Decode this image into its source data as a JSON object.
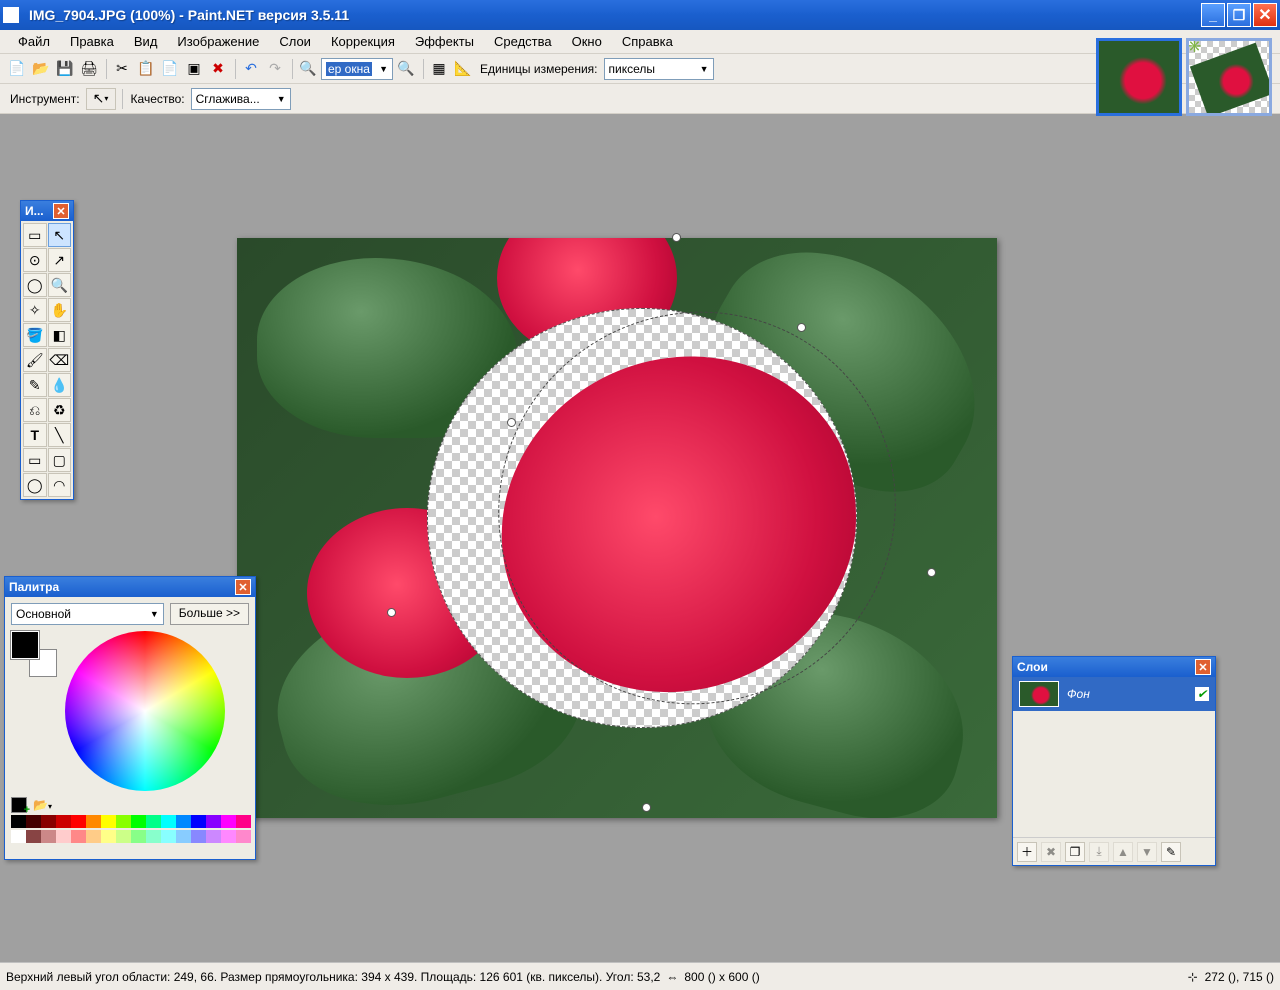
{
  "title": "IMG_7904.JPG (100%) - Paint.NET версия 3.5.11",
  "menu": {
    "file": "Файл",
    "edit": "Правка",
    "view": "Вид",
    "image": "Изображение",
    "layers": "Слои",
    "adjust": "Коррекция",
    "effects": "Эффекты",
    "tools": "Средства",
    "window": "Окно",
    "help": "Справка"
  },
  "toolbar1": {
    "zoom_select": "ер окна",
    "units_label": "Единицы измерения:",
    "units_value": "пикселы"
  },
  "toolbar2": {
    "tool_label": "Инструмент:",
    "quality_label": "Качество:",
    "quality_value": "Сглажива..."
  },
  "tools_panel_title": "И...",
  "palette": {
    "title": "Палитра",
    "mode": "Основной",
    "more": "Больше >>",
    "strip1": [
      "#000",
      "#400",
      "#800",
      "#c00",
      "#f00",
      "#f80",
      "#ff0",
      "#8f0",
      "#0f0",
      "#0f8",
      "#0ff",
      "#08f",
      "#00f",
      "#80f",
      "#f0f",
      "#f08"
    ],
    "strip2": [
      "#fff",
      "#844",
      "#c88",
      "#fcc",
      "#f88",
      "#fc8",
      "#ff8",
      "#cf8",
      "#8f8",
      "#8fc",
      "#8ff",
      "#8cf",
      "#88f",
      "#c8f",
      "#f8f",
      "#f8c"
    ]
  },
  "layers": {
    "title": "Слои",
    "bg": "Фон"
  },
  "statusbar": {
    "left": "Верхний левый угол области: 249, 66. Размер прямоугольника: 394 х 439. Площадь: 126 601 (кв. пикселы). Угол: 53,2",
    "dims": "800 () x 600 ()",
    "pos": "272 (), 715 ()"
  }
}
